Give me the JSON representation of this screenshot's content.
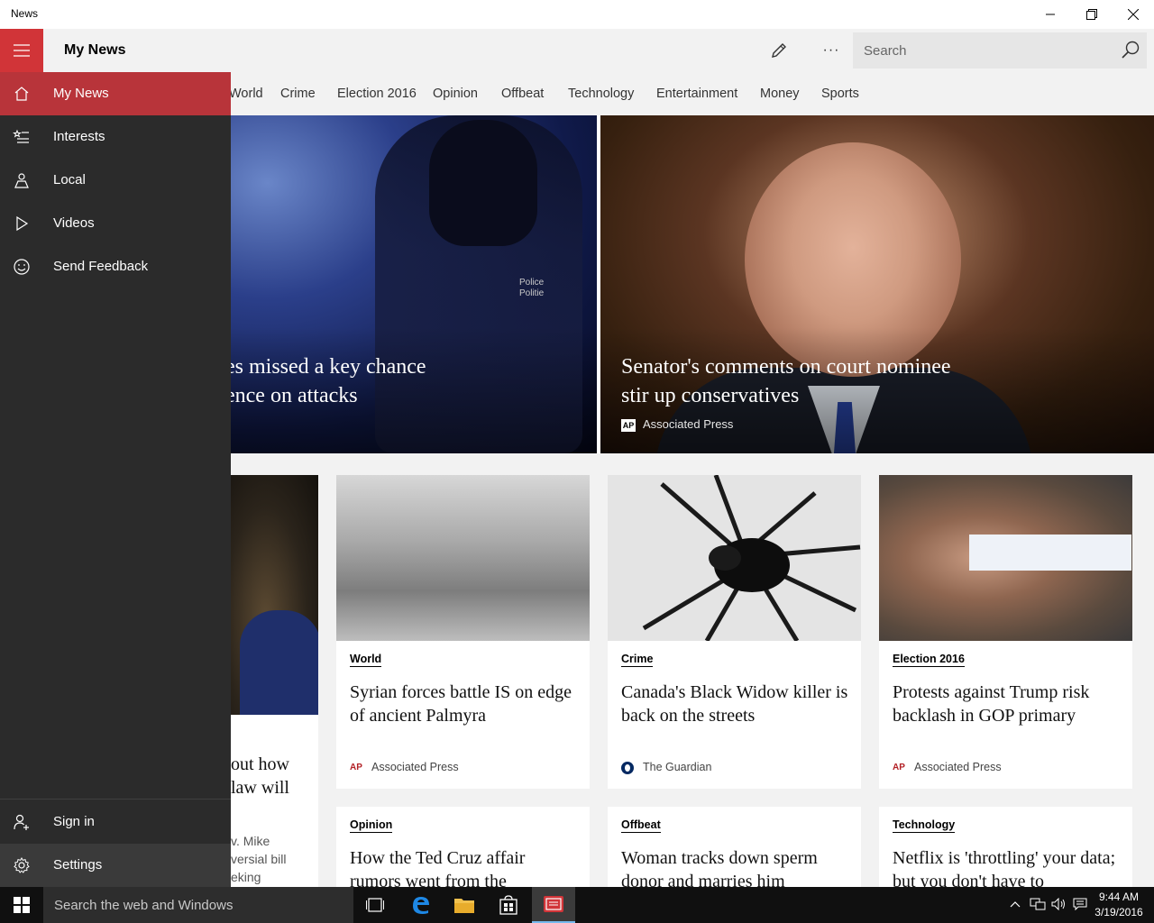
{
  "window": {
    "title": "News"
  },
  "header": {
    "title": "My News",
    "search_placeholder": "Search",
    "more_label": "···"
  },
  "categories": [
    "World",
    "Crime",
    "Election 2016",
    "Opinion",
    "Offbeat",
    "Technology",
    "Entertainment",
    "Money",
    "Sports"
  ],
  "nav": {
    "items": [
      {
        "label": "My News",
        "icon": "home-icon"
      },
      {
        "label": "Interests",
        "icon": "interests-icon"
      },
      {
        "label": "Local",
        "icon": "local-icon"
      },
      {
        "label": "Videos",
        "icon": "play-icon"
      },
      {
        "label": "Send Feedback",
        "icon": "smiley-icon"
      }
    ],
    "bottom": [
      {
        "label": "Sign in",
        "icon": "add-user-icon"
      },
      {
        "label": "Settings",
        "icon": "gear-icon"
      }
    ]
  },
  "hero": [
    {
      "title_line1": "es missed a key chance",
      "title_line2": "ence on attacks",
      "police_line1": "Police",
      "police_line2": "Politie"
    },
    {
      "title_line1": "Senator's comments on court nominee",
      "title_line2": "stir up conservatives",
      "source": "Associated Press",
      "logo": "AP"
    }
  ],
  "partial_card": {
    "title_line1": "out how",
    "title_line2": "law will",
    "body_line1": "v. Mike",
    "body_line2": "versial bill",
    "body_line3": "eking"
  },
  "cards": [
    {
      "category": "World",
      "title": "Syrian forces battle IS on edge of ancient Palmyra",
      "source": "Associated Press",
      "logo": "AP"
    },
    {
      "category": "Crime",
      "title": "Canada's Black Widow killer is back on the streets",
      "source": "The Guardian",
      "logo": "guardian"
    },
    {
      "category": "Election 2016",
      "title": "Protests against Trump risk backlash in GOP primary",
      "source": "Associated Press",
      "logo": "AP"
    },
    {
      "category": "Opinion",
      "title": "How the Ted Cruz affair rumors went from the"
    },
    {
      "category": "Offbeat",
      "title": "Woman tracks down sperm donor and marries him"
    },
    {
      "category": "Technology",
      "title": "Netflix is 'throttling' your data; but you don't have to"
    }
  ],
  "taskbar": {
    "search_text": "Search the web and Windows",
    "time": "9:44 AM",
    "date": "3/19/2016"
  },
  "colors": {
    "accent": "#d13438",
    "nav_active": "#b8343a",
    "nav_bg": "#2b2b2b"
  }
}
